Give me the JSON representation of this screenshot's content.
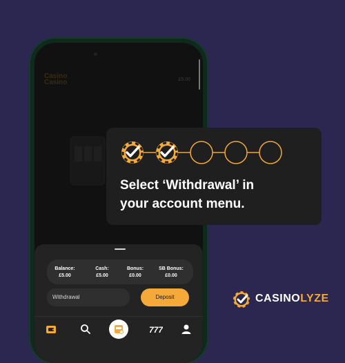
{
  "app": {
    "logo_line1": "Casino",
    "logo_line2": "Casino",
    "header_balance": "£5.00"
  },
  "sheet": {
    "balances": [
      {
        "label": "Balance:",
        "value": "£5.00"
      },
      {
        "label": "Cash:",
        "value": "£5.00"
      },
      {
        "label": "Bonus:",
        "value": "£0.00"
      },
      {
        "label": "SB Bonus:",
        "value": "£0.00"
      }
    ],
    "withdraw_label": "Withdrawal",
    "deposit_label": "Deposit"
  },
  "nav": {
    "icons": [
      "wallet-icon",
      "search-icon",
      "casino-icon",
      "slots-777-icon",
      "account-icon"
    ]
  },
  "callout": {
    "steps_total": 5,
    "steps_completed": 2,
    "text_line1": "Select ‘Withdrawal’ in",
    "text_line2": "your account menu."
  },
  "brand": {
    "name_part1": "CASINO",
    "name_part2": "LYZE"
  },
  "colors": {
    "background": "#2b2750",
    "accent": "#f4a938",
    "callout_bg": "#1f1f1f",
    "phone_frame": "#0f2a1d"
  }
}
